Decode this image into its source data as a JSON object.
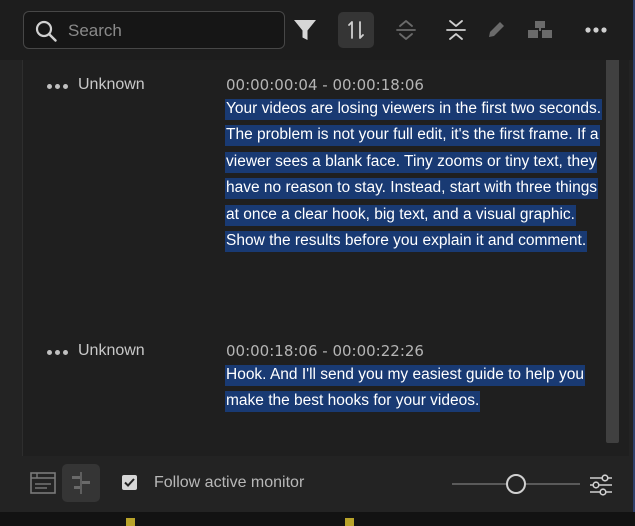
{
  "search": {
    "placeholder": "Search",
    "value": ""
  },
  "toolbar": {
    "filter_icon": "filter-icon",
    "buttons": [
      "sync-icon",
      "expand-collapse-icon",
      "merge-icon",
      "edit-icon",
      "speakers-icon",
      "more-icon"
    ]
  },
  "entries": [
    {
      "speaker": "Unknown",
      "timecode": "00:00:00:04 - 00:00:18:06",
      "text": "Your videos are losing viewers in the first two seconds. The problem is not your full edit, it's the first frame. If a viewer sees a blank face. Tiny zooms or tiny text, they have no reason to stay. Instead, start with three things at once a clear hook, big text, and a visual graphic. Show the results before you explain it and comment."
    },
    {
      "speaker": "Unknown",
      "timecode": "00:00:18:06 - 00:00:22:26",
      "text": "Hook. And I'll send you my easiest guide to help you make the best hooks for your videos."
    }
  ],
  "footer": {
    "follow_label": "Follow active monitor",
    "follow_checked": true,
    "zoom_fraction": 0.5
  },
  "colors": {
    "highlight": "#193a73",
    "panel_bg": "#232323",
    "content_bg": "#1f1f1f",
    "accent_border": "#2f3f6a"
  }
}
